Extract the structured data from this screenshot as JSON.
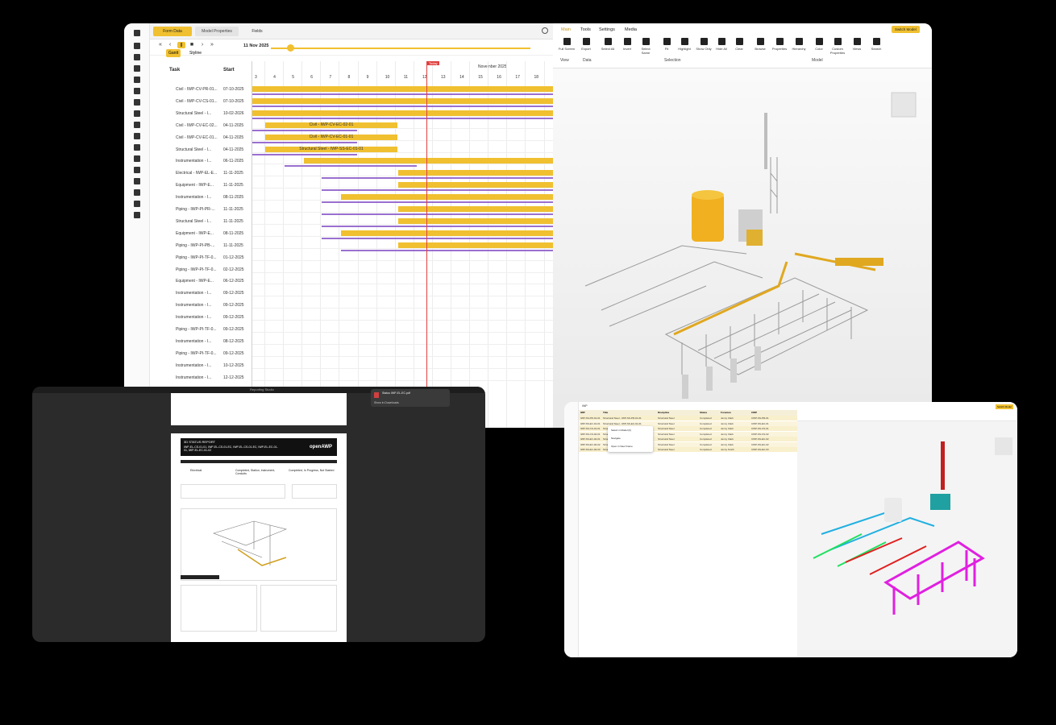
{
  "main": {
    "tabs": [
      "Form Data",
      "Model Properties",
      "Fields"
    ],
    "date": "11 Nov 2025",
    "view_tabs": [
      "Gantt",
      "Styline"
    ],
    "columns": [
      "Task",
      "Start"
    ],
    "today_label": "Today",
    "month_label": "November 2025",
    "days": [
      "3",
      "4",
      "5",
      "6",
      "7",
      "8",
      "9",
      "10",
      "11",
      "12",
      "13",
      "14",
      "15",
      "16",
      "17",
      "18"
    ],
    "tasks": [
      {
        "name": "Civil - IWP-CV-PR-01...",
        "start": "07-10-2025"
      },
      {
        "name": "Civil - IWP-CV-CS-01...",
        "start": "07-10-2025"
      },
      {
        "name": "Structural Steel - I...",
        "start": "10-02-2026"
      },
      {
        "name": "Civil - IWP-CV-EC-02...",
        "start": "04-11-2025"
      },
      {
        "name": "Civil - IWP-CV-EC-01...",
        "start": "04-11-2025"
      },
      {
        "name": "Structural Steel - I...",
        "start": "04-11-2025"
      },
      {
        "name": "Instrumentation - I...",
        "start": "06-11-2025"
      },
      {
        "name": "Electrical - IWP-EL-E...",
        "start": "11-11-2025"
      },
      {
        "name": "Equipment - IWP-E...",
        "start": "11-11-2025"
      },
      {
        "name": "Instrumentation - I...",
        "start": "08-11-2025"
      },
      {
        "name": "Piping - IWP-PI-PR-...",
        "start": "11-11-2025"
      },
      {
        "name": "Structural Steel - I...",
        "start": "11-11-2025"
      },
      {
        "name": "Equipment - IWP-E...",
        "start": "08-11-2025"
      },
      {
        "name": "Piping - IWP-PI-PB-...",
        "start": "11-11-2025"
      },
      {
        "name": "Piping - IWP-PI-TF-0...",
        "start": "01-12-2025"
      },
      {
        "name": "Piping - IWP-PI-TF-0...",
        "start": "02-12-2025"
      },
      {
        "name": "Equipment - IWP-E...",
        "start": "06-12-2025"
      },
      {
        "name": "Instrumentation - I...",
        "start": "09-12-2025"
      },
      {
        "name": "Instrumentation - I...",
        "start": "09-12-2025"
      },
      {
        "name": "Instrumentation - I...",
        "start": "09-12-2025"
      },
      {
        "name": "Piping - IWP-PI-TF-0...",
        "start": "09-12-2025"
      },
      {
        "name": "Instrumentation - I...",
        "start": "08-12-2025"
      },
      {
        "name": "Piping - IWP-PI-TF-0...",
        "start": "09-12-2025"
      },
      {
        "name": "Instrumentation - I...",
        "start": "10-12-2025"
      },
      {
        "name": "Instrumentation - I...",
        "start": "12-12-2025"
      }
    ],
    "bar_labels": [
      "Civil - IWP-CV-EC-02-01",
      "Civil - IWP-CV-EC-01-01",
      "Structural Steel - IWP-SS-EC-01-01"
    ],
    "ribbon_tabs": [
      "Main",
      "Tools",
      "Settings",
      "Media"
    ],
    "switch_label": "Switch Model",
    "ribbon_buttons": [
      "Full Screen",
      "Export",
      "Select All",
      "Invert",
      "Select Same",
      "Fit",
      "Highlight",
      "Show Only",
      "Hide All",
      "Clear",
      "Browse",
      "Properties",
      "Hierarchy",
      "Color",
      "Custom Properties",
      "Views",
      "Search"
    ],
    "groups": [
      "View",
      "Data",
      "Selection",
      "Model"
    ]
  },
  "report": {
    "window_title": "Reporting Studio",
    "notif_title": "Status IWP-EL-EC.pdf",
    "notif_action": "Show in Downloads",
    "heading": "3D STATUS REPORT",
    "subheading": "IWP-EL-CS-01-01, IWP-EL-CS-01-EC, IWP-EL-CS-01-EC, IWP-EL-EC-01-01, IWP-EL-EC-01-02",
    "brand": "openAWP",
    "fields": [
      "Electrical",
      "Completed, Station, Instrument, Conduits",
      "Completed, In Progress, Not Started"
    ]
  },
  "mini": {
    "title": "IWP",
    "headers": [
      "IWP",
      "Title",
      "Discipline",
      "Status",
      "Foreman",
      "CWP"
    ],
    "rows": [
      [
        "IWP-SS-PR-01-01",
        "Structural Steel - IWP-SS-PR-01-01",
        "Structural Steel",
        "Completed",
        "Jenny Clark",
        "CWP-SS-PR-01"
      ],
      [
        "IWP-SS-EC-01-01",
        "Structural Steel - IWP-SS-EC-01-01",
        "Structural Steel",
        "Completed",
        "Jenny Clark",
        "CWP-SS-EC-01"
      ],
      [
        "IWP-SS-CS-01-01",
        "Structural Steel - IWP-SS-CS-01-01",
        "Structural Steel",
        "Completed",
        "Jenny Clark",
        "CWP-SS-CS-01"
      ],
      [
        "IWP-SS-CS-02-01",
        "Structural Steel - IWP-SS-CS-02-01",
        "Structural Steel",
        "Completed",
        "Jenny Clark",
        "CWP-SS-CS-02"
      ],
      [
        "IWP-SS-EC-02-01",
        "Structural Steel - IWP-SS-EC-02-01",
        "Structural Steel",
        "Completed",
        "Jenny Clark",
        "CWP-SS-EC-02"
      ],
      [
        "IWP-SS-EC-02-02",
        "Structural Steel - IWP-SS-EC-02-02",
        "Structural Steel",
        "Completed",
        "Jenny Clark",
        "CWP-SS-EC-02"
      ],
      [
        "IWP-SS-EC-02-03",
        "Structural Steel - IWP-SS-EC-02-03",
        "Structural Steel",
        "Completed",
        "Jenny Smith",
        "CWP-SS-EC-03"
      ]
    ],
    "context_menu": [
      "Select in Model (F)",
      "Navigate",
      "Open in New Frame"
    ]
  }
}
